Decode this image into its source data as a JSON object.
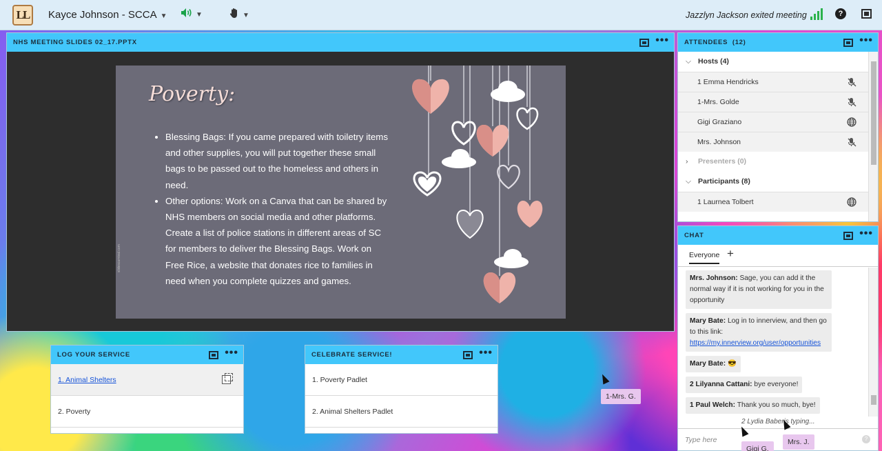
{
  "topbar": {
    "logo_text": "LL",
    "account_name": "Kayce Johnson - SCCA",
    "status_message": "Jazzlyn Jackson exited meeting",
    "help_label": "?"
  },
  "share_pod": {
    "title": "NHS MEETING SLIDES 02_17.PPTX",
    "more_label": "•••",
    "slide": {
      "heading": "Poverty:",
      "bullets": [
        "Blessing Bags: If you came prepared with toiletry items and other supplies, you will put together these small bags to be passed out to the homeless and others in need.",
        "Other options: Work on a Canva that can be shared by NHS members on social media and other platforms. Create a list of police stations in different areas of SC for members to deliver the Blessing Bags. Work on Free Rice, a website that donates rice to families in need when you complete quizzes and games."
      ],
      "credit": "slidescarnival.com"
    }
  },
  "log_pod": {
    "title": "LOG YOUR SERVICE",
    "more_label": "•••",
    "items": [
      "1. Animal Shelters",
      "2. Poverty"
    ]
  },
  "celebrate_pod": {
    "title": "CELEBRATE SERVICE!",
    "more_label": "•••",
    "items": [
      "1. Poverty Padlet",
      "2. Animal Shelters Padlet"
    ]
  },
  "attendees": {
    "title": "ATTENDEES",
    "count": "(12)",
    "more_label": "•••",
    "hosts_label": "Hosts (4)",
    "hosts": [
      {
        "name": "1 Emma Hendricks",
        "icon": "mic-muted-icon"
      },
      {
        "name": "1-Mrs. Golde",
        "icon": "mic-muted-icon"
      },
      {
        "name": "Gigi Graziano",
        "icon": "globe-icon"
      },
      {
        "name": "Mrs. Johnson",
        "icon": "mic-muted-icon"
      }
    ],
    "presenters_label": "Presenters (0)",
    "participants_label": "Participants (8)",
    "participants": [
      {
        "name": "1 Laurnea Tolbert",
        "icon": "globe-icon"
      }
    ]
  },
  "chat": {
    "title": "CHAT",
    "more_label": "•••",
    "tab_label": "Everyone",
    "add_label": "+",
    "messages": [
      {
        "sender": "Mrs. Johnson:",
        "text": "Sage, you can add it the normal way if it is not working for you in the opportunity"
      },
      {
        "sender": "Mary Bate:",
        "text": "Log in to innerview, and then go to this link:",
        "link": "https://my.innerview.org/user/opportunities"
      },
      {
        "sender": "Mary Bate:",
        "text": "😎"
      },
      {
        "sender": "2 Lilyanna Cattani:",
        "text": "bye everyone!"
      },
      {
        "sender": "1 Paul Welch:",
        "text": "Thank you so much, bye!"
      }
    ],
    "typing": "2 Lydia Baberis typing...",
    "input_placeholder": "Type here",
    "info_label": "?"
  },
  "cursor_tags": [
    "1-Mrs. G.",
    "Gigi G.",
    "Mrs. J."
  ],
  "colors": {
    "topbar_bg": "#ddedf8",
    "pod_header": "#42c7fb",
    "stage_bg": "#2d2d2d",
    "slide_bg": "#6c6b78",
    "speaker_green": "#1aa34a",
    "link_blue": "#1452d8"
  }
}
